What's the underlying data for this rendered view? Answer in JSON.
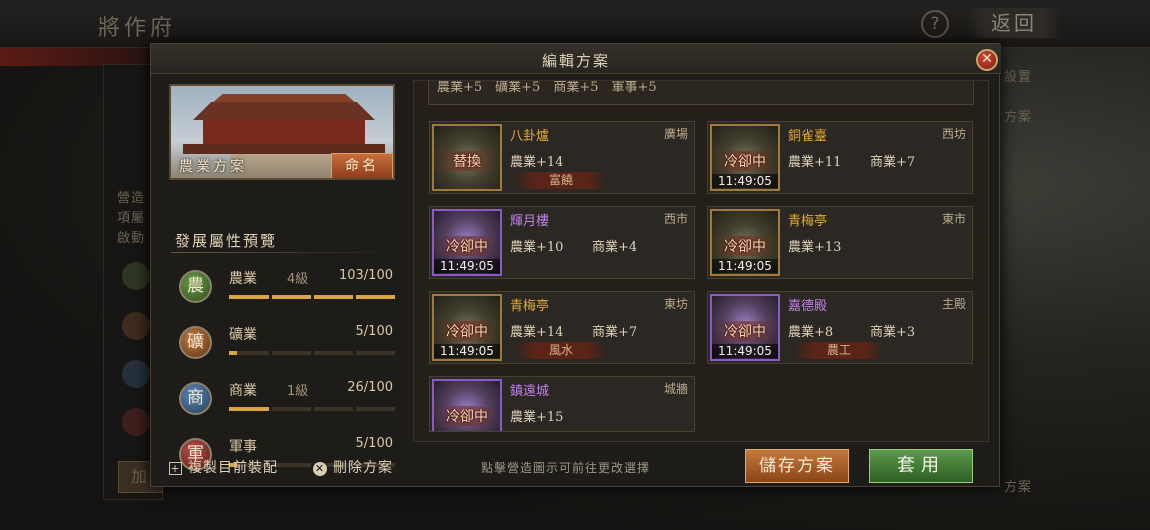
{
  "background": {
    "title": "將作府",
    "help_icon": "?",
    "back_label": "返回",
    "side_texts": [
      "設置",
      "方案",
      "方案"
    ],
    "left_lines": [
      "營造",
      "項屬",
      "啟動"
    ],
    "left_icons": [
      "農",
      "礦",
      "商",
      "軍"
    ],
    "bottom_button": "加"
  },
  "modal": {
    "title": "編輯方案",
    "close_icon": "✕",
    "plan_name": "農業方案",
    "rename_label": "命名",
    "preview_title": "發展屬性預覽",
    "attributes": [
      {
        "icon": "農",
        "name": "農業",
        "level": "4級",
        "value": "103/100",
        "progress": 1.0
      },
      {
        "icon": "礦",
        "name": "礦業",
        "level": "",
        "value": "5/100",
        "progress": 0.05
      },
      {
        "icon": "商",
        "name": "商業",
        "level": "1級",
        "value": "26/100",
        "progress": 0.26
      },
      {
        "icon": "軍",
        "name": "軍事",
        "level": "",
        "value": "5/100",
        "progress": 0.05
      }
    ],
    "top_strip": "農業+5　礦業+5　商業+5　軍事+5",
    "buildings": [
      {
        "name": "八卦爐",
        "location": "廣場",
        "status": "替換",
        "timer": "",
        "stat1": "農業+14",
        "stat2": "",
        "tag": "富饒",
        "rarity": "gold"
      },
      {
        "name": "銅雀臺",
        "location": "西坊",
        "status": "冷卻中",
        "timer": "11:49:05",
        "stat1": "農業+11",
        "stat2": "商業+7",
        "tag": "",
        "rarity": "gold"
      },
      {
        "name": "輝月樓",
        "location": "西市",
        "status": "冷卻中",
        "timer": "11:49:05",
        "stat1": "農業+10",
        "stat2": "商業+4",
        "tag": "",
        "rarity": "purple"
      },
      {
        "name": "青梅亭",
        "location": "東市",
        "status": "冷卻中",
        "timer": "11:49:05",
        "stat1": "農業+13",
        "stat2": "",
        "tag": "",
        "rarity": "gold"
      },
      {
        "name": "青梅亭",
        "location": "東坊",
        "status": "冷卻中",
        "timer": "11:49:05",
        "stat1": "農業+14",
        "stat2": "商業+7",
        "tag": "風水",
        "rarity": "gold"
      },
      {
        "name": "嘉德殿",
        "location": "主殿",
        "status": "冷卻中",
        "timer": "11:49:05",
        "stat1": "農業+8",
        "stat2": "商業+3",
        "tag": "農工",
        "rarity": "purple"
      },
      {
        "name": "鎮遠城",
        "location": "城牆",
        "status": "冷卻中",
        "timer": "",
        "stat1": "農業+15",
        "stat2": "",
        "tag": "",
        "rarity": "purple"
      }
    ],
    "copy_label": "複製目前裝配",
    "delete_label": "刪除方案",
    "hint": "點擊營造圖示可前往更改選擇",
    "save_label": "儲存方案",
    "apply_label": "套用",
    "colors": {
      "gold_title": "#e0aa3c",
      "purple_title": "#c281ea",
      "accent_bar": "#d9a646",
      "save": "#a85a28",
      "apply": "#3f7a34",
      "close": "#b0301f"
    }
  }
}
